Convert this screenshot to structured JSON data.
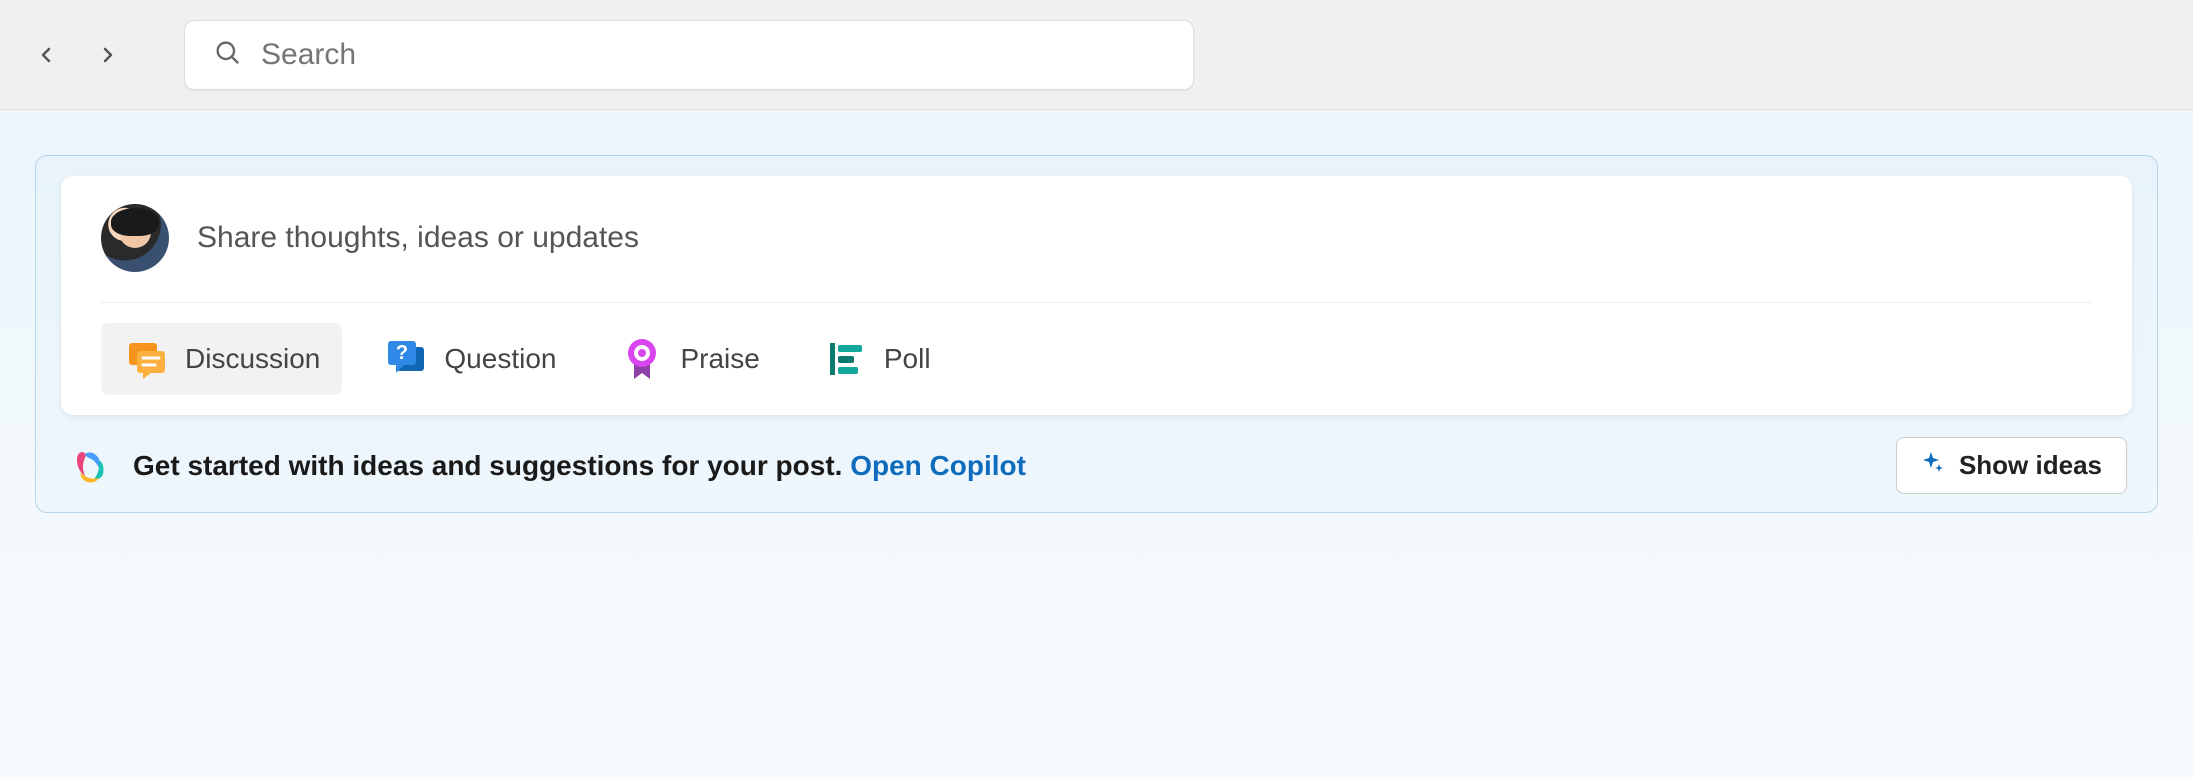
{
  "header": {
    "search_placeholder": "Search"
  },
  "composer": {
    "placeholder": "Share thoughts, ideas or updates",
    "post_types": {
      "discussion": "Discussion",
      "question": "Question",
      "praise": "Praise",
      "poll": "Poll"
    }
  },
  "copilot": {
    "prompt_text": "Get started with ideas and suggestions for your post. ",
    "link_text": "Open Copilot",
    "show_ideas_label": "Show ideas"
  }
}
